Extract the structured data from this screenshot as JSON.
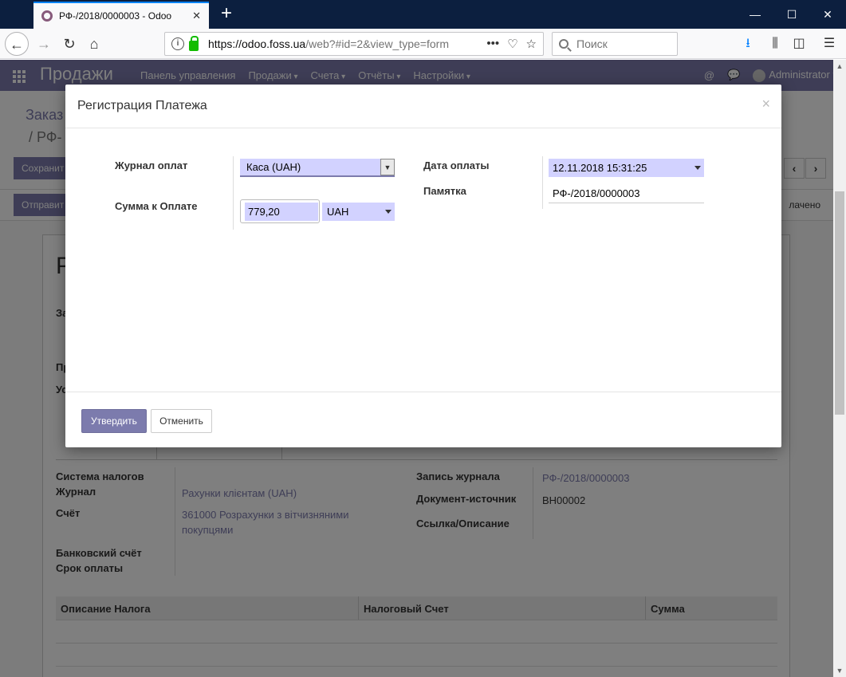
{
  "browser": {
    "tab_title": "РФ-/2018/0000003 - Odoo",
    "tab_close": "✕",
    "new_tab": "+",
    "url_domain": "https://odoo.foss.ua",
    "url_path": "/web?#id=2&view_type=form",
    "search_placeholder": "Поиск",
    "window_controls": {
      "minimize": "—",
      "maximize": "☐",
      "close": "✕"
    }
  },
  "odoo": {
    "app_name": "Продажи",
    "menu": [
      {
        "label": "Панель управления"
      },
      {
        "label": "Продажи"
      },
      {
        "label": "Счета"
      },
      {
        "label": "Отчёты"
      },
      {
        "label": "Настройки"
      }
    ],
    "user": "Administrator",
    "breadcrumb_root": "Заказ",
    "breadcrumb_current": "/ РФ-",
    "save_button": "Сохранит",
    "send_button": "Отправит",
    "paid_status": "лачено",
    "record_title": "Р",
    "stubs": [
      "За",
      "Пр",
      "Ус"
    ],
    "details": {
      "tax_system_label": "Система налогов",
      "journal_label": "Журнал",
      "journal_value": "Рахунки клієнтам (UAH)",
      "account_label": "Счёт",
      "account_value_line1": "361000 Розрахунки з вітчизняними",
      "account_value_line2": "покупцями",
      "bank_account_label": "Банковский счёт",
      "due_label": "Срок оплаты",
      "journal_entry_label": "Запись журнала",
      "journal_entry_value": "РФ-/2018/0000003",
      "source_doc_label": "Документ-источник",
      "source_doc_value": "ВН00002",
      "reference_label": "Ссылка/Описание"
    },
    "tax_table": {
      "columns": [
        "Описание Налога",
        "Налоговый Счет",
        "Сумма"
      ]
    }
  },
  "modal": {
    "title": "Регистрация Платежа",
    "close": "×",
    "journal_label": "Журнал оплат",
    "journal_value": "Каса (UAH)",
    "amount_label": "Сумма к Оплате",
    "amount_value": "779,20",
    "currency_value": "UAH",
    "date_label": "Дата оплаты",
    "date_value": "12.11.2018 15:31:25",
    "memo_label": "Памятка",
    "memo_value": "РФ-/2018/0000003",
    "confirm_button": "Утвердить",
    "cancel_button": "Отменить"
  },
  "colors": {
    "brand": "#7c7bad",
    "field_highlight": "#d2d2ff",
    "titlebar": "#0c1f3f",
    "link": "#7c7bad"
  }
}
